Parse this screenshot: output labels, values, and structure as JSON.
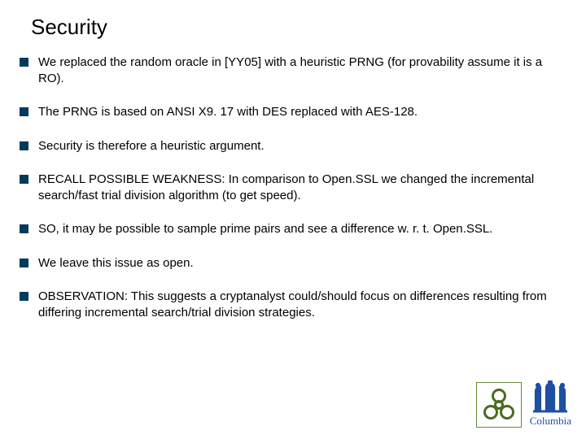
{
  "title": "Security",
  "bullets": [
    "We replaced the random oracle in [YY05] with a heuristic PRNG (for provability assume it is a RO).",
    "The PRNG is based on ANSI X9. 17 with DES replaced with AES-128.",
    "Security is therefore a heuristic argument.",
    "RECALL POSSIBLE WEAKNESS: In comparison to Open.SSL we changed the incremental search/fast trial division algorithm (to get speed).",
    "SO, it may be possible to sample prime pairs and see a difference w. r. t. Open.SSL.",
    "We leave this issue as open.",
    "OBSERVATION: This suggests a cryptanalyst could/should focus on differences resulting from differing incremental search/trial division strategies."
  ],
  "logos": {
    "columbia_label": "Columbia"
  }
}
